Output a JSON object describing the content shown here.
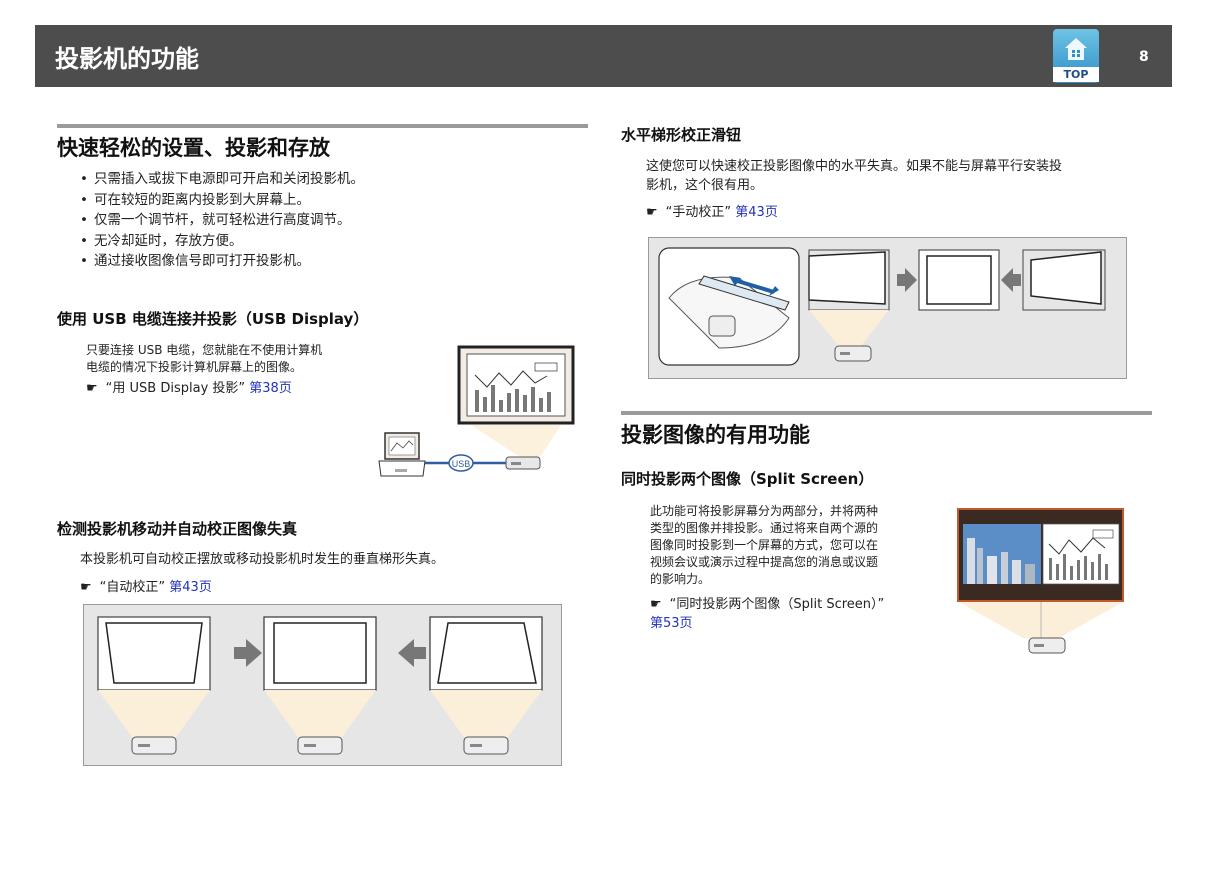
{
  "header": {
    "title": "投影机的功能",
    "top_label": "TOP",
    "page_number": "8"
  },
  "section1": {
    "title": "快速轻松的设置、投影和存放",
    "bullets": [
      "只需插入或拔下电源即可开启和关闭投影机。",
      "可在较短的距离内投影到大屏幕上。",
      "仅需一个调节杆，就可轻松进行高度调节。",
      "无冷却延时，存放方便。",
      "通过接收图像信号即可打开投影机。"
    ]
  },
  "usb": {
    "title": "使用 USB 电缆连接并投影（USB Display）",
    "text_lines": [
      "只要连接 USB 电缆，您就能在不使用计算机",
      "电缆的情况下投影计算机屏幕上的图像。"
    ],
    "ref_symbol": "☛",
    "ref_text": "“用 USB Display 投影”",
    "ref_link": "第38页",
    "usb_label": "USB"
  },
  "detect": {
    "title": "检测投影机移动并自动校正图像失真",
    "text": "本投影机可自动校正摆放或移动投影机时发生的垂直梯形失真。",
    "ref_symbol": "☛",
    "ref_text": "“自动校正”",
    "ref_link": "第43页"
  },
  "slider": {
    "title": "水平梯形校正滑钮",
    "text_lines": [
      "这使您可以快速校正投影图像中的水平失真。如果不能与屏幕平行安装投",
      "影机，这个很有用。"
    ],
    "ref_symbol": "☛",
    "ref_text": "“手动校正”",
    "ref_link": "第43页"
  },
  "section2": {
    "title": "投影图像的有用功能"
  },
  "split": {
    "title": "同时投影两个图像（Split Screen）",
    "text_lines": [
      "此功能可将投影屏幕分为两部分，并将两种",
      "类型的图像并排投影。通过将来自两个源的",
      "图像同时投影到一个屏幕的方式，您可以在",
      "视频会议或演示过程中提高您的消息或议题",
      "的影响力。"
    ],
    "ref_symbol": "☛",
    "ref_text": "“同时投影两个图像（Split Screen）”",
    "ref_link": "第53页"
  },
  "colors": {
    "header_bg": "#4d4d4d",
    "link": "#2233bb",
    "top_icon": "#3a9fd4"
  }
}
